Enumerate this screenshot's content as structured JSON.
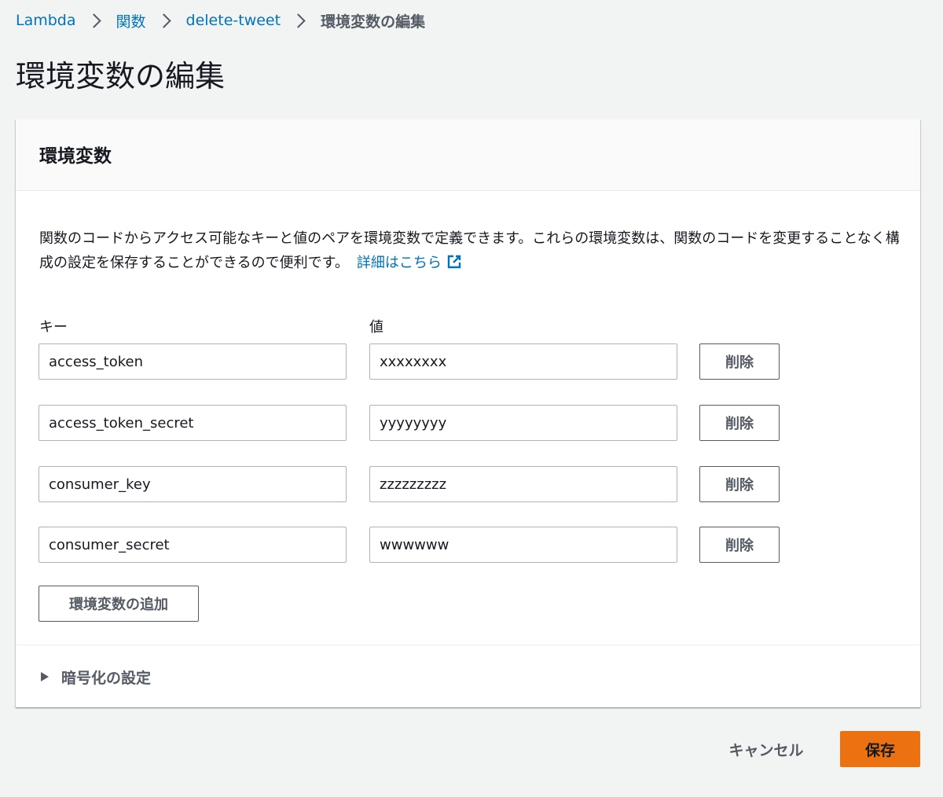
{
  "breadcrumb": {
    "items": [
      "Lambda",
      "関数",
      "delete-tweet"
    ],
    "current": "環境変数の編集"
  },
  "page": {
    "title": "環境変数の編集"
  },
  "panel": {
    "title": "環境変数",
    "description": "関数のコードからアクセス可能なキーと値のペアを環境変数で定義できます。これらの環境変数は、関数のコードを変更することなく構成の設定を保存することができるので便利です。",
    "learn_more": "詳細はこちら",
    "key_label": "キー",
    "value_label": "値",
    "variables": [
      {
        "key": "access_token",
        "value": "xxxxxxxx"
      },
      {
        "key": "access_token_secret",
        "value": "yyyyyyyy"
      },
      {
        "key": "consumer_key",
        "value": "zzzzzzzzz"
      },
      {
        "key": "consumer_secret",
        "value": "wwwwww"
      }
    ],
    "delete_label": "削除",
    "add_label": "環境変数の追加",
    "encryption_label": "暗号化の設定"
  },
  "footer": {
    "cancel_label": "キャンセル",
    "save_label": "保存"
  },
  "colors": {
    "link": "#0073bb",
    "primary": "#ec7211",
    "background": "#f2f3f3"
  },
  "icons": {
    "breadcrumb_separator": "chevron-right-icon",
    "external_link": "external-link-icon",
    "expander": "caret-right-icon"
  }
}
